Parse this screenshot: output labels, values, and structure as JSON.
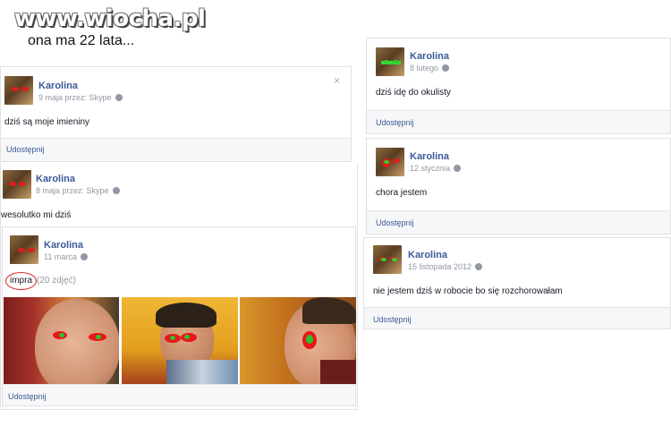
{
  "site": {
    "logo": "www.wiocha.pl"
  },
  "caption": "ona ma 22 lata...",
  "colors": {
    "link": "#3b5998",
    "meta": "#9197a3",
    "mark_red": "#e8161a",
    "mark_green": "#27c42a"
  },
  "posts_left": [
    {
      "author": "Karolina",
      "meta": "9 maja przez: Skype",
      "text": "dziś są moje imieniny",
      "share": "Udostępnij",
      "close_icon": "×"
    },
    {
      "author": "Karolina",
      "meta": "8 maja przez: Skype",
      "text": "wesolutko mi dziś"
    },
    {
      "author": "Karolina",
      "meta": "11 marca",
      "album": "impra",
      "album_count": "(20 zdjęć)",
      "share": "Udostępnij"
    }
  ],
  "posts_right": [
    {
      "author": "Karolina",
      "meta": "8 lutego",
      "text": "dziś idę do okulisty",
      "share": "Udostępnij"
    },
    {
      "author": "Karolina",
      "meta": "12 stycznia",
      "text": "chora jestem",
      "share": "Udostępnij"
    },
    {
      "author": "Karolina",
      "meta": "15 listopada 2012",
      "text": "nie jestem dziś w robocie bo się rozchorowałam",
      "share": "Udostępnij"
    }
  ]
}
